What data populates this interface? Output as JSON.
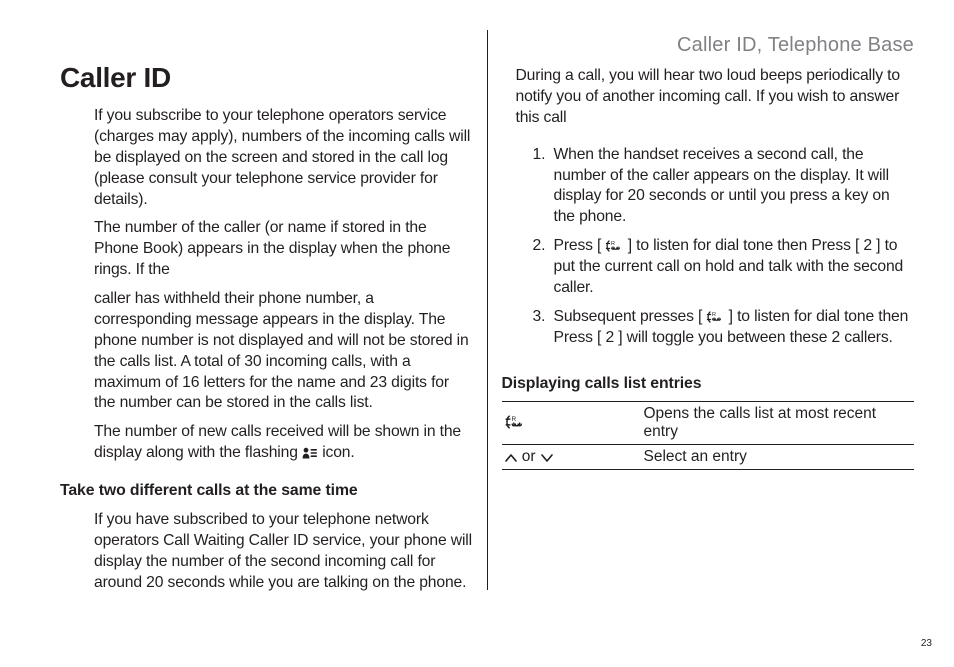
{
  "running_head": "Caller ID, Telephone Base",
  "page_number": "23",
  "title": "Caller ID",
  "left": {
    "p1": "If you subscribe to your telephone operators service (charges may apply), numbers of the incoming calls will be displayed on the screen and stored in the call log (please consult your telephone service provider for details).",
    "p2": "The number of the caller (or name if stored in the Phone Book) appears in the display when the phone rings. If the",
    "p3": "caller has withheld their phone number, a corresponding message appears in the display. The phone number is not displayed and will not be stored in the calls list. A total of 30 incoming calls, with a maximum of 16 letters for the name and 23 digits for the number can be stored in the calls list.",
    "p4a": "The number of new calls received will be shown in the display along with the flashing ",
    "p4b": " icon.",
    "h2": "Take two different calls at the same time",
    "p5": "If you have subscribed to your telephone network operators Call Waiting Caller ID service, your phone will display the number of the second incoming call for around 20 seconds while you are talking on the phone."
  },
  "right": {
    "p1": "During a call, you will hear two loud beeps periodically to notify you of another incoming call. If you wish to answer this call",
    "li1": "When the handset receives a second call, the number of the caller appears on the display. It will display for 20 seconds or until you press a key on the phone.",
    "li2a": "Press [ ",
    "li2b": " ] to listen for dial tone then Press [ 2 ] to put the current call on hold and talk with the second caller.",
    "li3a": "Subsequent presses [ ",
    "li3b": " ] to listen for dial tone then Press [ 2 ] will toggle you between these 2 callers.",
    "h2": "Displaying calls list entries",
    "table": {
      "r1_val": "Opens the calls list at most recent entry",
      "r2_key_mid": " or ",
      "r2_val": "Select an entry"
    }
  },
  "icons": {
    "calls_key": "calls-key-icon",
    "caller_id": "caller-id-icon",
    "up": "up-arrow-icon",
    "down": "down-arrow-icon"
  }
}
